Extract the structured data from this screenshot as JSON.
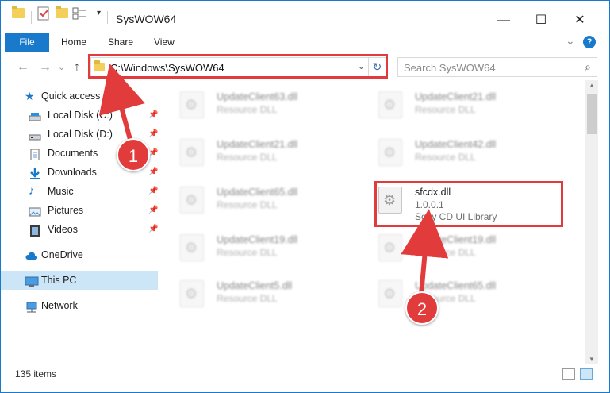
{
  "window": {
    "title": "SysWOW64",
    "controls": {
      "minimize": "—",
      "maximize": "☐",
      "close": "✕"
    }
  },
  "ribbon": {
    "tabs": [
      "File",
      "Home",
      "Share",
      "View"
    ],
    "expand_glyph": "⌄",
    "help_glyph": "?"
  },
  "address": {
    "back_glyph": "←",
    "forward_glyph": "→",
    "history_glyph": "⌄",
    "up_glyph": "↑",
    "path": "C:\\Windows\\SysWOW64",
    "dropdown_glyph": "⌄",
    "refresh_glyph": "↻"
  },
  "search": {
    "placeholder": "Search SysWOW64",
    "icon": "search-icon",
    "glyph": "⌕"
  },
  "nav": {
    "quick_access": "Quick access",
    "items": [
      {
        "label": "Local Disk (C:)",
        "icon": "drive-icon",
        "pinned": true
      },
      {
        "label": "Local Disk (D:)",
        "icon": "drive-icon",
        "pinned": true
      },
      {
        "label": "Documents",
        "icon": "documents-icon",
        "pinned": true
      },
      {
        "label": "Downloads",
        "icon": "downloads-icon",
        "pinned": true
      },
      {
        "label": "Music",
        "icon": "music-icon",
        "pinned": true
      },
      {
        "label": "Pictures",
        "icon": "pictures-icon",
        "pinned": true
      },
      {
        "label": "Videos",
        "icon": "videos-icon",
        "pinned": true
      }
    ],
    "onedrive": "OneDrive",
    "this_pc": "This PC",
    "network": "Network",
    "pin_glyph": "📌"
  },
  "files": {
    "left": [
      {
        "name": "UpdateClient63.dll",
        "type": "Resource DLL"
      },
      {
        "name": "UpdateClient21.dll",
        "type": "Resource DLL"
      },
      {
        "name": "UpdateClient65.dll",
        "type": "Resource DLL"
      },
      {
        "name": "UpdateClient19.dll",
        "type": "Resource DLL"
      },
      {
        "name": "UpdateClient5.dll",
        "type": "Resource DLL"
      }
    ],
    "right": [
      {
        "name": "UpdateClient21.dll",
        "type": "Resource DLL"
      },
      {
        "name": "UpdateClient42.dll",
        "type": "Resource DLL"
      },
      {
        "name": "sfcdx.dll",
        "version": "1.0.0.1",
        "type": "Sony CD UI Library",
        "highlighted": true
      },
      {
        "name": "UpdateClient19.dll",
        "type": "Resource DLL"
      },
      {
        "name": "UpdateClient65.dll",
        "type": "Resource DLL"
      }
    ]
  },
  "status": {
    "item_count": "135 items"
  },
  "markers": {
    "one": "1",
    "two": "2"
  },
  "colors": {
    "accent": "#1979ca",
    "highlight": "#e23b3b",
    "selected": "#cde6f7"
  }
}
